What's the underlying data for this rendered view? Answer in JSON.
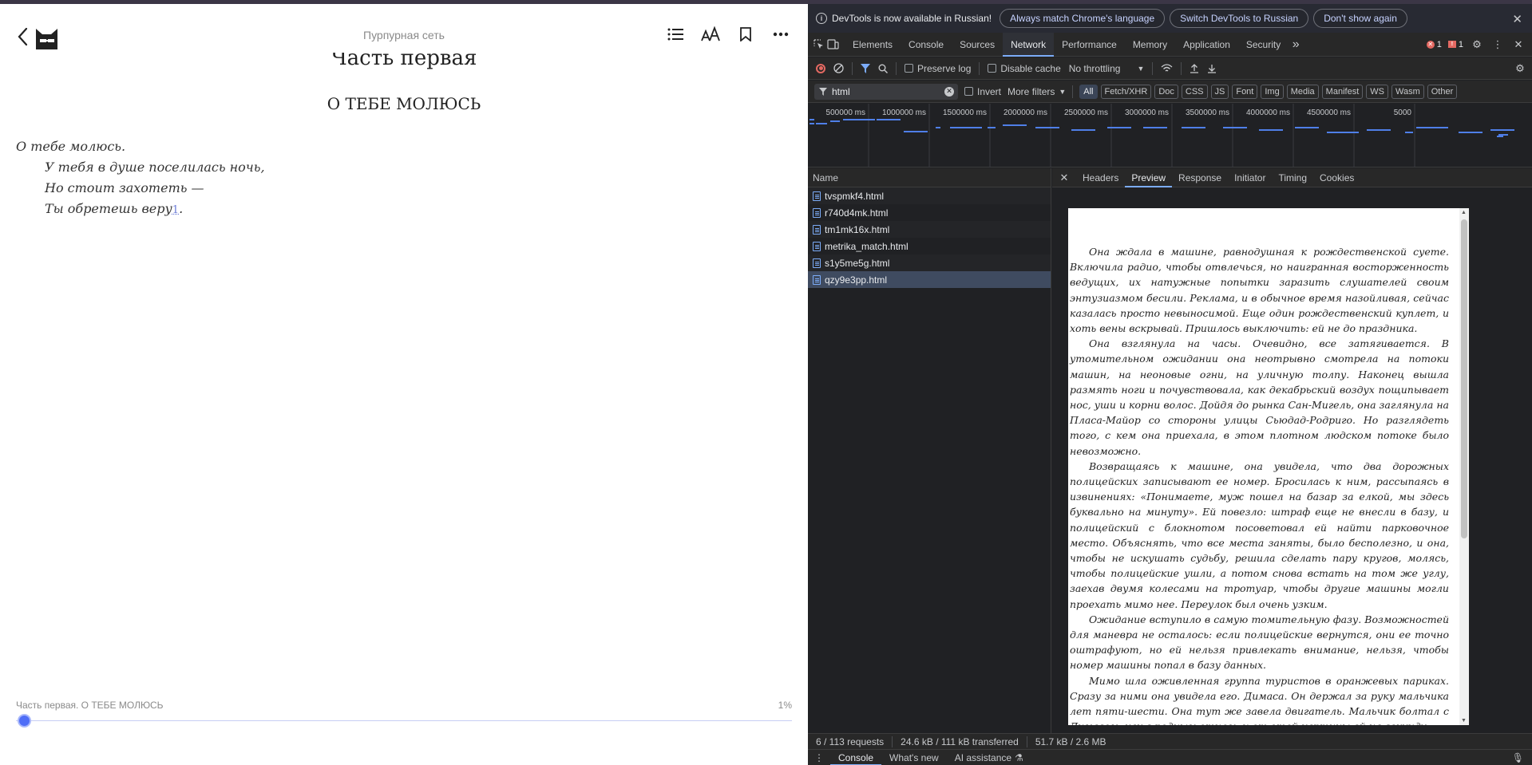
{
  "reader": {
    "book_title": "Пурпурная сеть",
    "part_heading": "Часть первая",
    "chapter_heading": "О ТЕБЕ МОЛЮСЬ",
    "poem": {
      "line1": "О тебе молюсь.",
      "line2": "У тебя в душе поселилась ночь,",
      "line3": "Но стоит захотеть —",
      "line4": "Ты обретешь веру",
      "footnote": "1",
      "line4_end": "."
    },
    "footer_label": "Часть первая. О ТЕБЕ МОЛЮСЬ",
    "progress_label": "1%",
    "progress_value": 0.01,
    "icons": {
      "back": "chevron-left-icon",
      "logo": "cat-logo-icon",
      "toc": "list-icon",
      "font": "font-size-icon",
      "bookmark": "bookmark-icon",
      "more": "more-icon"
    }
  },
  "devtools": {
    "infobar": {
      "text": "DevTools is now available in Russian!",
      "btn1": "Always match Chrome's language",
      "btn2": "Switch DevTools to Russian",
      "btn3": "Don't show again"
    },
    "tabs": [
      "Elements",
      "Console",
      "Sources",
      "Network",
      "Performance",
      "Memory",
      "Application",
      "Security"
    ],
    "active_tab": "Network",
    "more_tabs": "»",
    "error_count": "1",
    "issue_count": "1",
    "toolbar": {
      "preserve_log": "Preserve log",
      "disable_cache": "Disable cache",
      "throttling": "No throttling"
    },
    "filter": {
      "value": "html",
      "invert": "Invert",
      "more_filters": "More filters",
      "types": [
        "All",
        "Fetch/XHR",
        "Doc",
        "CSS",
        "JS",
        "Font",
        "Img",
        "Media",
        "Manifest",
        "WS",
        "Wasm",
        "Other"
      ]
    },
    "timeline_labels": [
      "500000 ms",
      "1000000 ms",
      "1500000 ms",
      "2000000 ms",
      "2500000 ms",
      "3000000 ms",
      "3500000 ms",
      "4000000 ms",
      "4500000 ms",
      "5000"
    ],
    "name_header": "Name",
    "requests": [
      "tvspmkf4.html",
      "r740d4mk.html",
      "tm1mk16x.html",
      "metrika_match.html",
      "s1y5me5g.html",
      "qzy9e3pp.html"
    ],
    "detail_tabs": [
      "Headers",
      "Preview",
      "Response",
      "Initiator",
      "Timing",
      "Cookies"
    ],
    "active_detail_tab": "Preview",
    "preview_paragraphs": [
      "Она ждала в машине, равнодушная к рождественской суете. Включила радио, чтобы отвлечься, но наигранная восторженность ведущих, их натужные попытки заразить слушателей своим энтузиазмом бесили. Реклама, и в обычное время назойливая, сейчас казалась просто невыносимой. Еще один рождественский куплет, и хоть вены вскрывай. Пришлось выключить: ей не до праздника.",
      "Она взглянула на часы. Очевидно, все затягивается. В утомительном ожидании она неотрывно смотрела на потоки машин, на неоновые огни, на уличную толпу. Наконец вышла размять ноги и почувствовала, как декабрьский воздух пощипывает нос, уши и корни волос. Дойдя до рынка Сан-Мигель, она заглянула на Пласа-Майор со стороны улицы Сьюдад-Родриго. Но разглядеть того, с кем она приехала, в этом плотном людском потоке было невозможно.",
      "Возвращаясь к машине, она увидела, что два дорожных полицейских записывают ее номер. Бросилась к ним, рассыпаясь в извинениях: «Понимаете, муж пошел на базар за елкой, мы здесь буквально на минуту». Ей повезло: штраф еще не внесли в базу, и полицейский с блокнотом посоветовал ей найти парковочное место. Объяснять, что все места заняты, было бесполезно, и она, чтобы не искушать судьбу, решила сделать пару кругов, молясь, чтобы полицейские ушли, а потом снова встать на том же углу, заехав двумя колесами на тротуар, чтобы другие машины могли проехать мимо нее. Переулок был очень узким.",
      "Ожидание вступило в самую томительную фазу. Возможностей для маневра не осталось: если полицейские вернутся, они ее точно оштрафуют, но ей нельзя привлекать внимание, нельзя, чтобы номер машины попал в базу данных.",
      "Мимо шла оживленная группа туристов в оранжевых париках. Сразу за ними она увидела его. Димаса. Он держал за руку мальчика лет пяти-шести. Она тут же завела двигатель. Мальчик болтал с Димасом, как с родным отцом, и от этой картины ей на секунду"
    ],
    "status": {
      "requests": "6 / 113 requests",
      "transferred": "24.6 kB / 111 kB transferred",
      "resources": "51.7 kB / 2.6 MB"
    },
    "drawer_tabs": [
      "Console",
      "What's new",
      "AI assistance"
    ]
  }
}
